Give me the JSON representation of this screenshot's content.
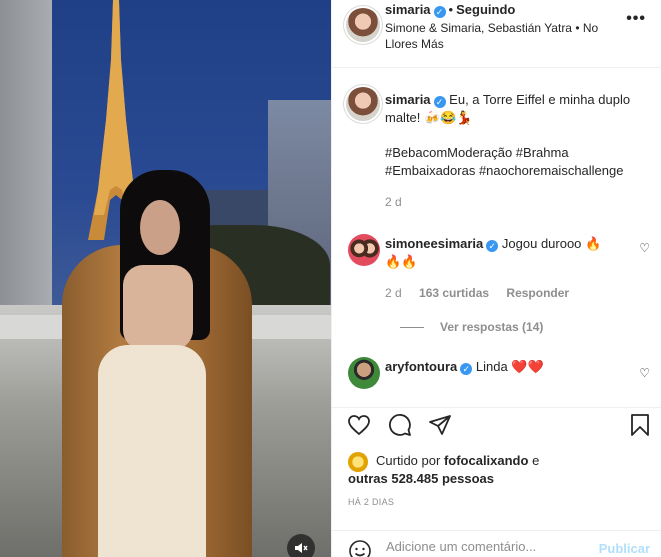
{
  "post": {
    "author": "simaria",
    "following_label": "Seguindo",
    "audio": "Simone & Simaria, Sebastián Yatra • No Llores Más",
    "more_icon": "more-horizontal-icon"
  },
  "caption": {
    "author": "simaria",
    "text": "Eu, a Torre Eiffel e minha duplo malte! 🍻😂💃",
    "hashtags_line1": "#BebacomModeração #Brahma",
    "hashtags_line2": "#Embaixadoras #naochoremaischallenge",
    "age": "2 d"
  },
  "comments": [
    {
      "author": "simoneesimaria",
      "text": "Jogou durooo 🔥",
      "text2": "🔥🔥",
      "age": "2 d",
      "likes": "163 curtidas",
      "reply_label": "Responder",
      "view_replies": "Ver respostas (14)"
    },
    {
      "author": "aryfontoura",
      "text": "Linda ❤️❤️"
    }
  ],
  "likes": {
    "prefix": "Curtido por",
    "user": "fofocalixando",
    "conjunction": "e",
    "others": "outras 528.485 pessoas"
  },
  "timestamp": "HÁ 2 DIAS",
  "composer": {
    "placeholder": "Adicione um comentário...",
    "publish_label": "Publicar"
  },
  "colors": {
    "link": "#00376b",
    "verified": "#3897f0",
    "muted": "#8e8e8e",
    "publish_disabled": "#b2dffc"
  }
}
